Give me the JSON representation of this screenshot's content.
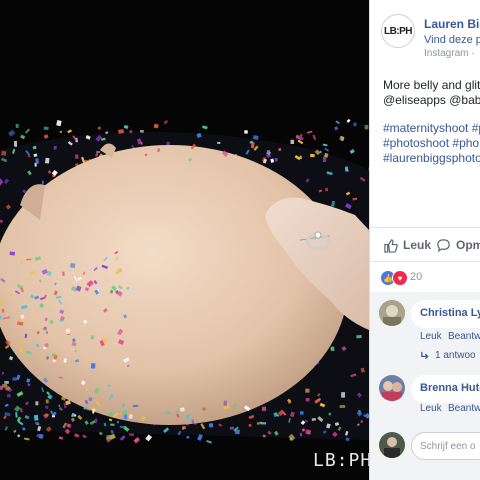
{
  "photo": {
    "watermark": "LB:PH",
    "colors": {
      "background": "#050505",
      "skin": "#e6cab4",
      "confetti": [
        "#8a3fd1",
        "#3f7be8",
        "#e84a9a",
        "#4fc4d8",
        "#f0c040",
        "#5ad07a",
        "#ffffff",
        "#e85b3a"
      ]
    }
  },
  "post": {
    "logo_text": "LB:PH",
    "page_name": "Lauren Big",
    "follow_text": "Vind deze pa",
    "source": "Instagram · ",
    "text_line1": "More belly and glitt",
    "text_line2": "@eliseapps @baby",
    "hashtags": [
      "#maternityshoot #p",
      "#photoshoot #pho",
      "#laurenbiggsphoto"
    ],
    "like_label": "Leuk",
    "comment_label": "Opm",
    "reaction_count": "20",
    "icons": [
      "thumbs-up-icon",
      "comment-icon",
      "like-reaction-icon",
      "love-reaction-icon",
      "reply-arrow-icon"
    ]
  },
  "comments": [
    {
      "name": "Christina Ly",
      "like": "Leuk",
      "reply": "Beantw",
      "replies": "1 antwoo"
    },
    {
      "name": "Brenna Hutc",
      "like": "Leuk",
      "reply": "Beantw"
    }
  ],
  "composer": {
    "placeholder": "Schrijf een o"
  }
}
